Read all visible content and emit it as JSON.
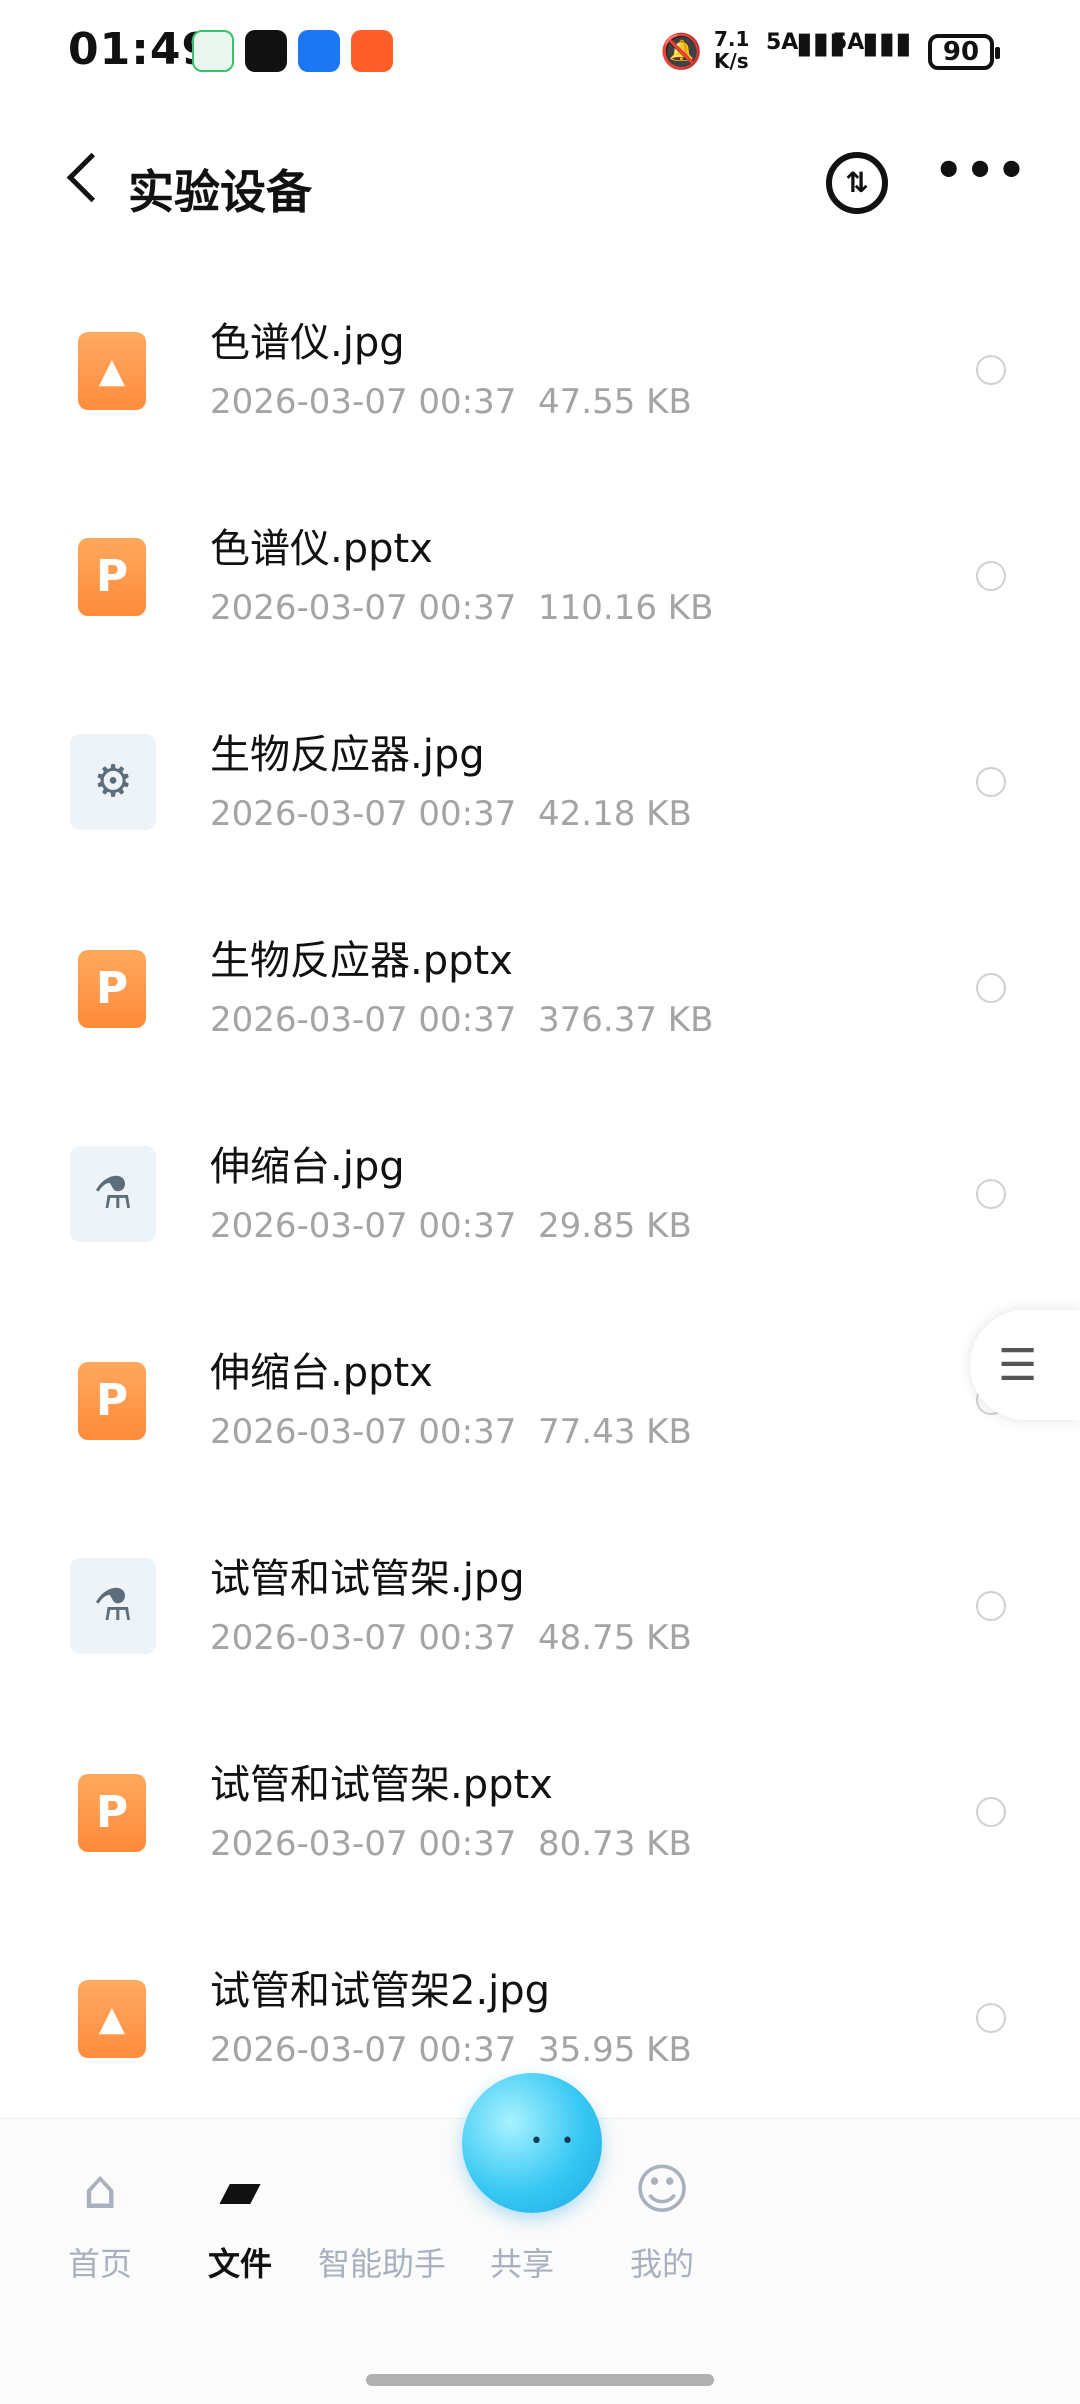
{
  "status_bar": {
    "time": "01:49",
    "network_speed": "7.1 K/s",
    "sim1": "5A",
    "sim2": "5A",
    "battery": "90",
    "icons": [
      "sync-icon",
      "qq-icon",
      "browser-icon",
      "taobao-icon",
      "mute-bell-icon"
    ]
  },
  "header": {
    "title": "实验设备",
    "sort_icon": "⇅",
    "more_icon": "•••"
  },
  "files": [
    {
      "name": "色谱仪.jpg",
      "date": "2026-03-07 00:37",
      "size": "47.55 KB",
      "type": "image",
      "icon_glyph": "▲"
    },
    {
      "name": "色谱仪.pptx",
      "date": "2026-03-07 00:37",
      "size": "110.16 KB",
      "type": "pptx",
      "icon_glyph": "P"
    },
    {
      "name": "生物反应器.jpg",
      "date": "2026-03-07 00:37",
      "size": "42.18 KB",
      "type": "photo",
      "icon_glyph": "⚙"
    },
    {
      "name": "生物反应器.pptx",
      "date": "2026-03-07 00:37",
      "size": "376.37 KB",
      "type": "pptx",
      "icon_glyph": "P"
    },
    {
      "name": "伸缩台.jpg",
      "date": "2026-03-07 00:37",
      "size": "29.85 KB",
      "type": "photo",
      "icon_glyph": "⚗"
    },
    {
      "name": "伸缩台.pptx",
      "date": "2026-03-07 00:37",
      "size": "77.43 KB",
      "type": "pptx",
      "icon_glyph": "P"
    },
    {
      "name": "试管和试管架.jpg",
      "date": "2026-03-07 00:37",
      "size": "48.75 KB",
      "type": "photo",
      "icon_glyph": "⚗"
    },
    {
      "name": "试管和试管架.pptx",
      "date": "2026-03-07 00:37",
      "size": "80.73 KB",
      "type": "pptx",
      "icon_glyph": "P"
    },
    {
      "name": "试管和试管架2.jpg",
      "date": "2026-03-07 00:37",
      "size": "35.95 KB",
      "type": "image",
      "icon_glyph": "▲"
    }
  ],
  "side_handle_icon": "☰",
  "bottom_nav": {
    "items": [
      {
        "label": "首页",
        "icon": "⌂",
        "icon_name": "home-icon",
        "active": false
      },
      {
        "label": "文件",
        "icon": "▰",
        "icon_name": "folder-icon",
        "active": true
      },
      {
        "label": "智能助手",
        "icon": "",
        "icon_name": "assistant-icon",
        "active": false
      },
      {
        "label": "共享",
        "icon": "➤",
        "icon_name": "share-icon",
        "active": false
      },
      {
        "label": "我的",
        "icon": "☺",
        "icon_name": "profile-icon",
        "active": false
      }
    ],
    "assistant_face": "••"
  }
}
